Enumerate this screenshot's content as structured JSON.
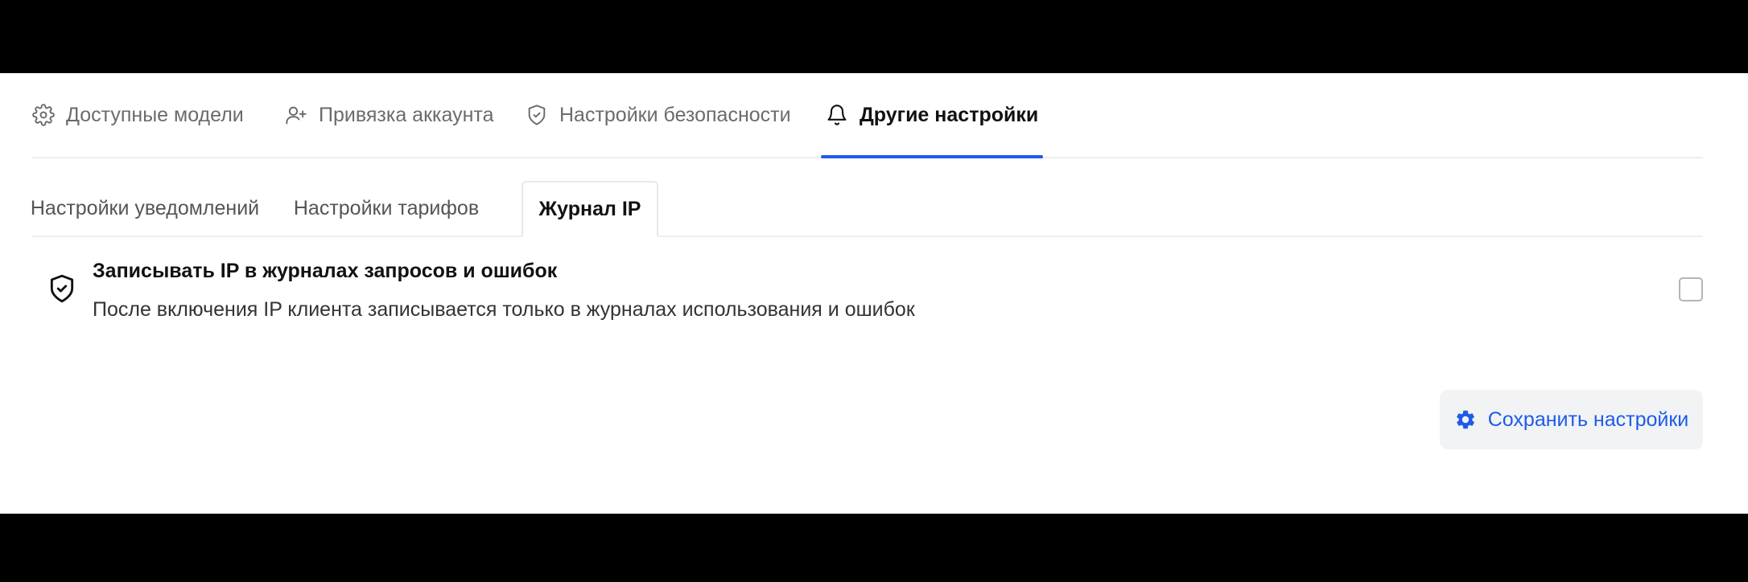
{
  "main_tabs": [
    {
      "label": "Доступные модели",
      "icon": "gear-icon"
    },
    {
      "label": "Привязка аккаунта",
      "icon": "user-plus-icon"
    },
    {
      "label": "Настройки безопасности",
      "icon": "shield-check-icon"
    },
    {
      "label": "Другие настройки",
      "icon": "bell-icon",
      "active": true
    }
  ],
  "sub_tabs": [
    {
      "label": "Настройки уведомлений"
    },
    {
      "label": "Настройки тарифов"
    },
    {
      "label": "Журнал IP",
      "active": true
    }
  ],
  "setting": {
    "title": "Записывать IP в журналах запросов и ошибок",
    "description": "После включения IP клиента записывается только в журналах использования и ошибок",
    "checked": false,
    "icon": "shield-check-icon"
  },
  "save_button": {
    "label": "Сохранить настройки",
    "icon": "gear-icon"
  },
  "colors": {
    "accent": "#1e5bea",
    "button_bg": "#f2f3f5",
    "divider": "#eeeeee"
  }
}
